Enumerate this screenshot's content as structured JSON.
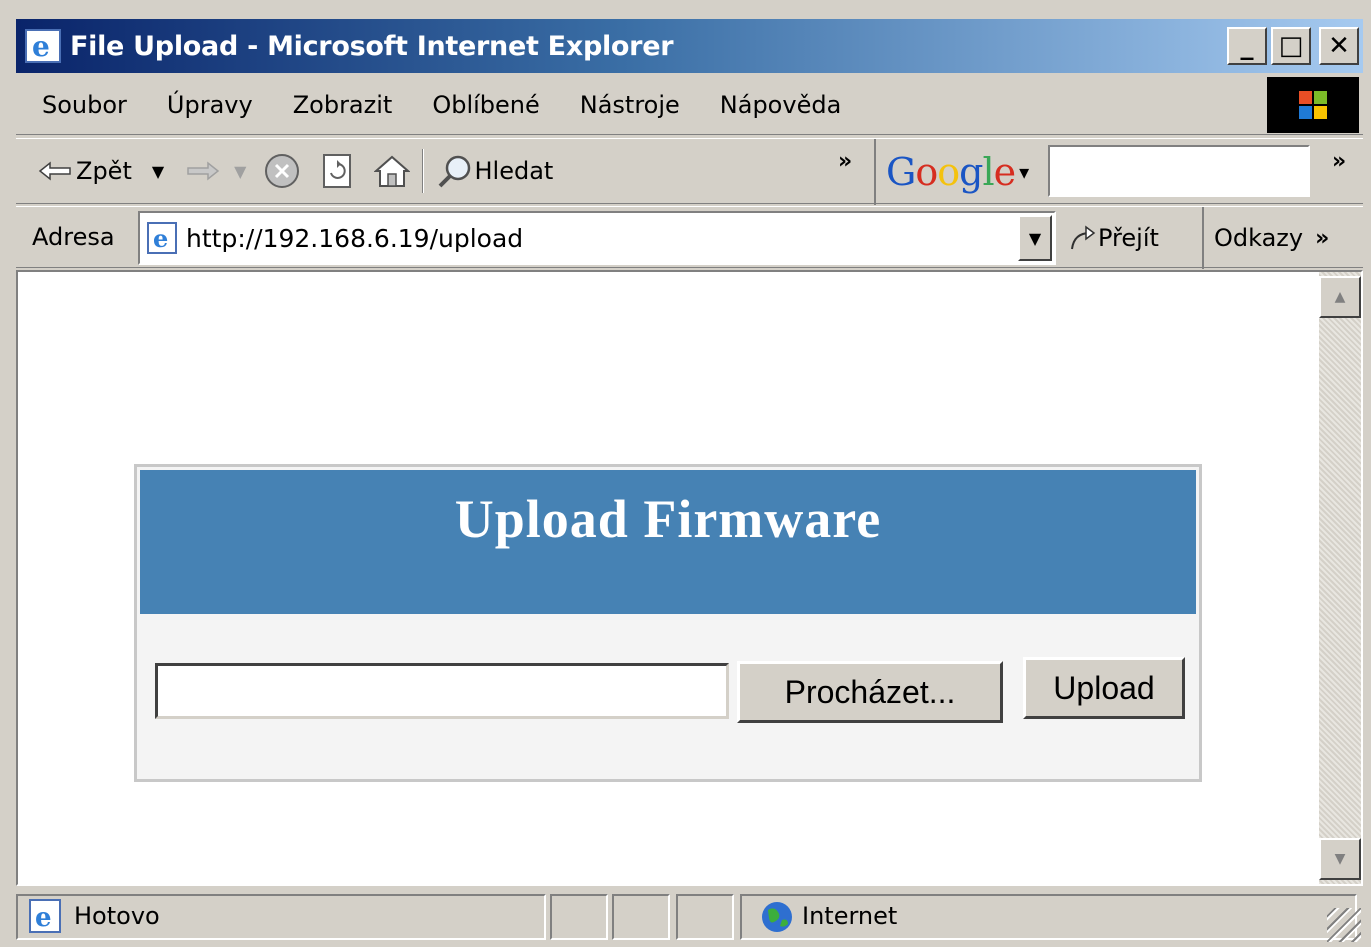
{
  "window": {
    "title": "File Upload - Microsoft Internet Explorer",
    "caption_buttons": {
      "minimize": "_",
      "maximize": "□",
      "close": "✕"
    }
  },
  "menu": {
    "items": [
      "Soubor",
      "Úpravy",
      "Zobrazit",
      "Oblíbené",
      "Nástroje",
      "Nápověda"
    ]
  },
  "toolbar": {
    "back_label": "Zpět",
    "search_label": "Hledat",
    "more_chevron": "»",
    "google_logo": "Google",
    "google_dropdown": "▾",
    "google_more": "»"
  },
  "address": {
    "label": "Adresa",
    "url": "http://192.168.6.19/upload",
    "go_label": "Přejít",
    "links_label": "Odkazy",
    "links_more": "»"
  },
  "page": {
    "heading": "Upload Firmware",
    "file_value": "",
    "browse_label": "Procházet...",
    "upload_label": "Upload"
  },
  "status": {
    "text": "Hotovo",
    "zone": "Internet"
  },
  "colors": {
    "panel_header": "#4682b4",
    "title_gradient_start": "#0a246a",
    "title_gradient_end": "#a6caf0",
    "chrome": "#d4d0c8"
  },
  "icons": [
    "ie-app-icon",
    "windows-logo-icon",
    "back-arrow-icon",
    "forward-arrow-icon",
    "stop-icon",
    "refresh-icon",
    "home-icon",
    "search-icon",
    "page-icon",
    "go-arrow-icon",
    "globe-icon",
    "resize-grip-icon"
  ]
}
